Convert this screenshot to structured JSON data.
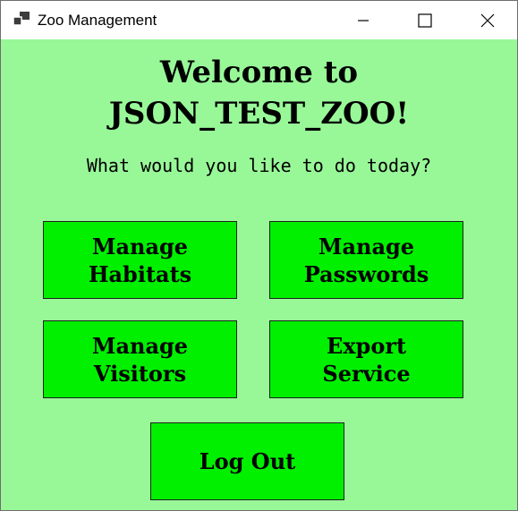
{
  "window": {
    "title": "Zoo Management",
    "icon": "app-window-icon",
    "controls": {
      "minimize": "minimize-icon",
      "maximize": "maximize-icon",
      "close": "close-icon"
    }
  },
  "colors": {
    "background": "#98f898",
    "button": "#00f000",
    "button_border": "#1f1f1f",
    "text": "#000000"
  },
  "welcome": {
    "line1": "Welcome to",
    "line2": "JSON_TEST_ZOO!"
  },
  "prompt": "What would you like to do today?",
  "buttons": {
    "habitats": {
      "line1": "Manage",
      "line2": "Habitats"
    },
    "passwords": {
      "line1": "Manage",
      "line2": "Passwords"
    },
    "visitors": {
      "line1": "Manage",
      "line2": "Visitors"
    },
    "export": {
      "line1": "Export",
      "line2": "Service"
    },
    "logout": {
      "label": "Log Out"
    }
  }
}
